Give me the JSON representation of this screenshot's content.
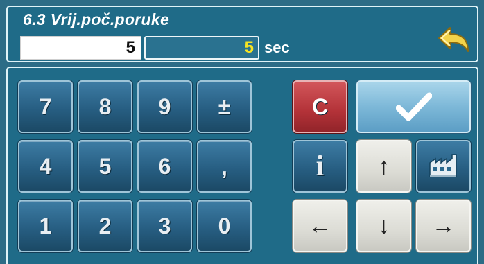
{
  "header": {
    "title": "6.3 Vrij.poč.poruke",
    "current_value": "5",
    "edit_value": "5",
    "unit": "sec"
  },
  "keypad": {
    "keys": [
      "7",
      "8",
      "9",
      "±",
      "4",
      "5",
      "6",
      ",",
      "1",
      "2",
      "3",
      "0"
    ]
  },
  "controls": {
    "clear_label": "C",
    "info_label": "i",
    "up_label": "↑",
    "down_label": "↓",
    "left_label": "←",
    "right_label": "→"
  },
  "colors": {
    "background": "#1f6b88",
    "edit_value": "#f6e323",
    "clear_button": "#b33238",
    "confirm_button": "#7db8d8",
    "nav_button": "#dcdcd5"
  },
  "icons": {
    "back": "back-arrow-icon",
    "confirm": "checkmark-icon",
    "factory": "factory-reset-icon"
  }
}
